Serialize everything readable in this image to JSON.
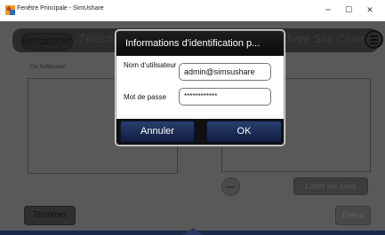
{
  "window": {
    "title": "Fenêtre Principale - SimUshare",
    "minimize_glyph": "─",
    "maximize_glyph": "☐",
    "close_glyph": "✕"
  },
  "header": {
    "back_label": "PRECEDENT",
    "title_left": "Télécha",
    "title_right": "hare Sim Cloud"
  },
  "main": {
    "reference_label": "Clu Référentiel",
    "list_sims_label": "Lister les sims",
    "finish_label": "Terminer",
    "start_label": "Début"
  },
  "dialog": {
    "title": "Informations d'identification p...",
    "username_label": "Nom d'utilisateur",
    "username_value": "admin@simsushare",
    "password_label": "Mot de passe",
    "password_value": "************",
    "cancel_label": "Annuler",
    "ok_label": "OK"
  },
  "colors": {
    "overlay_bg": "#595959",
    "dialog_header": "#111111",
    "button_blue": "#1f2f5a"
  }
}
